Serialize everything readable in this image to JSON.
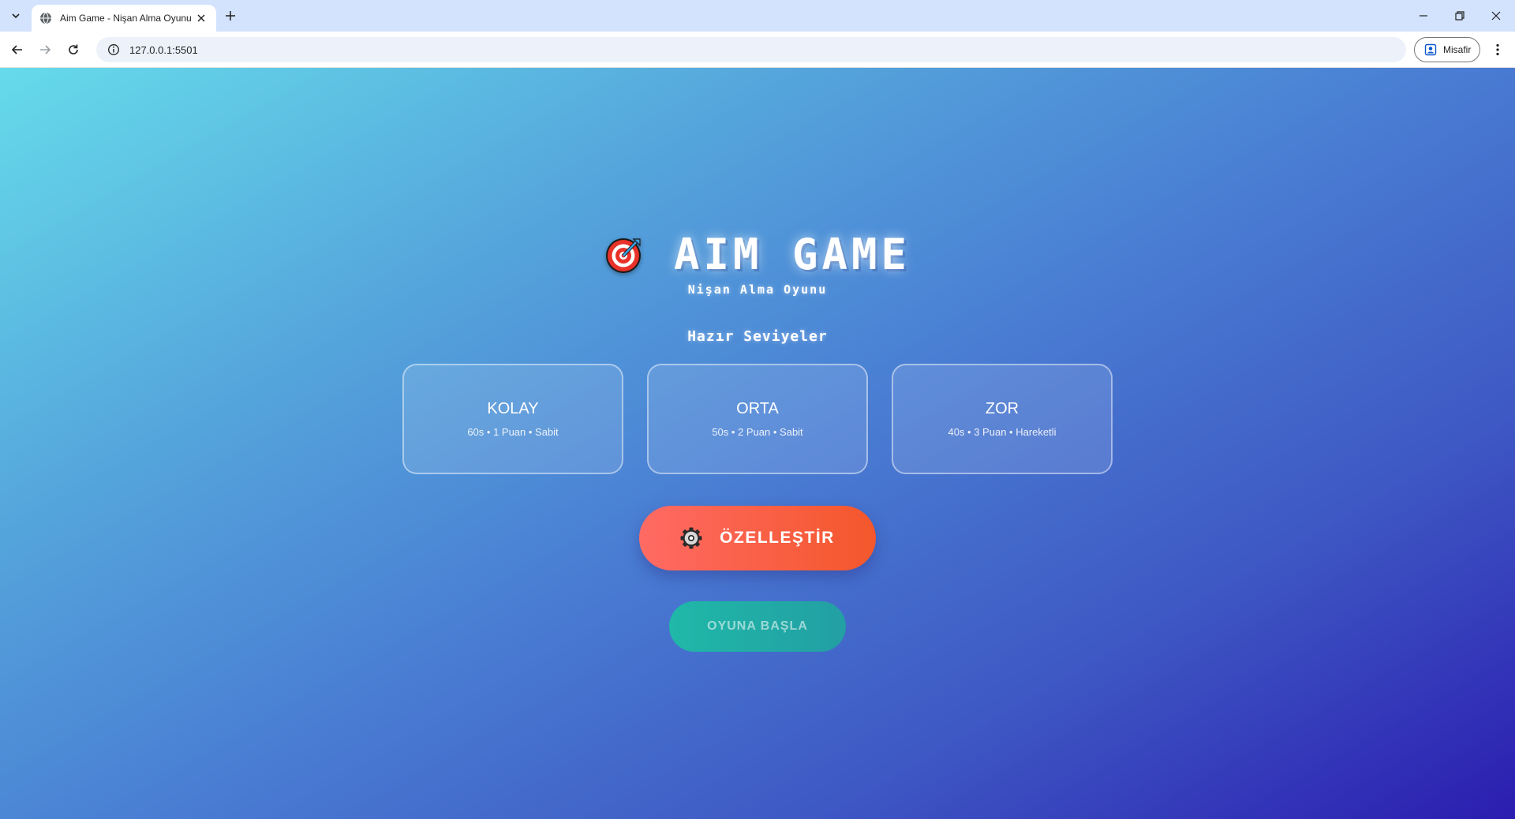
{
  "browser": {
    "tab_title": "Aim Game - Nişan Alma Oyunu",
    "url": "127.0.0.1:5501",
    "profile_label": "Misafir"
  },
  "game": {
    "title": "AIM GAME",
    "subtitle": "Nişan Alma Oyunu",
    "levels_heading": "Hazır Seviyeler",
    "levels": [
      {
        "name": "KOLAY",
        "details": "60s • 1 Puan • Sabit"
      },
      {
        "name": "ORTA",
        "details": "50s • 2 Puan • Sabit"
      },
      {
        "name": "ZOR",
        "details": "40s • 3 Puan • Hareketli"
      }
    ],
    "customize_label": "ÖZELLEŞTİR",
    "start_label": "OYUNA BAŞLA"
  },
  "icons": {
    "title_icon": "target-icon",
    "customize_icon": "gear-icon"
  },
  "colors": {
    "customize_button": "#f4572b",
    "start_button": "#20b8a8",
    "background_top": "#66dbea",
    "background_bottom": "#2b1db0"
  }
}
